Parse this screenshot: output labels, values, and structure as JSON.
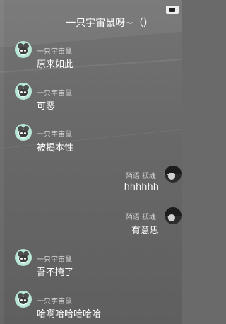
{
  "header": {
    "title": "一只宇宙鼠呀~（）"
  },
  "messages": [
    {
      "side": "left",
      "sender": "一只宇宙鼠",
      "text": "原来如此",
      "avatar": "mouse-avatar"
    },
    {
      "side": "left",
      "sender": "一只宇宙鼠",
      "text": "可恶",
      "avatar": "mouse-avatar"
    },
    {
      "side": "left",
      "sender": "一只宇宙鼠",
      "text": "被揭本性",
      "avatar": "mouse-avatar"
    },
    {
      "side": "right",
      "sender": "陌语.孤魂",
      "text": "hhhhhh",
      "avatar": "ghost-avatar"
    },
    {
      "side": "right",
      "sender": "陌语.孤魂",
      "text": "有意思",
      "avatar": "ghost-avatar"
    },
    {
      "side": "left",
      "sender": "一只宇宙鼠",
      "text": "吾不掩了",
      "avatar": "mouse-avatar"
    },
    {
      "side": "left",
      "sender": "一只宇宙鼠",
      "text": "哈啊哈哈哈哈哈",
      "avatar": "mouse-avatar"
    }
  ]
}
